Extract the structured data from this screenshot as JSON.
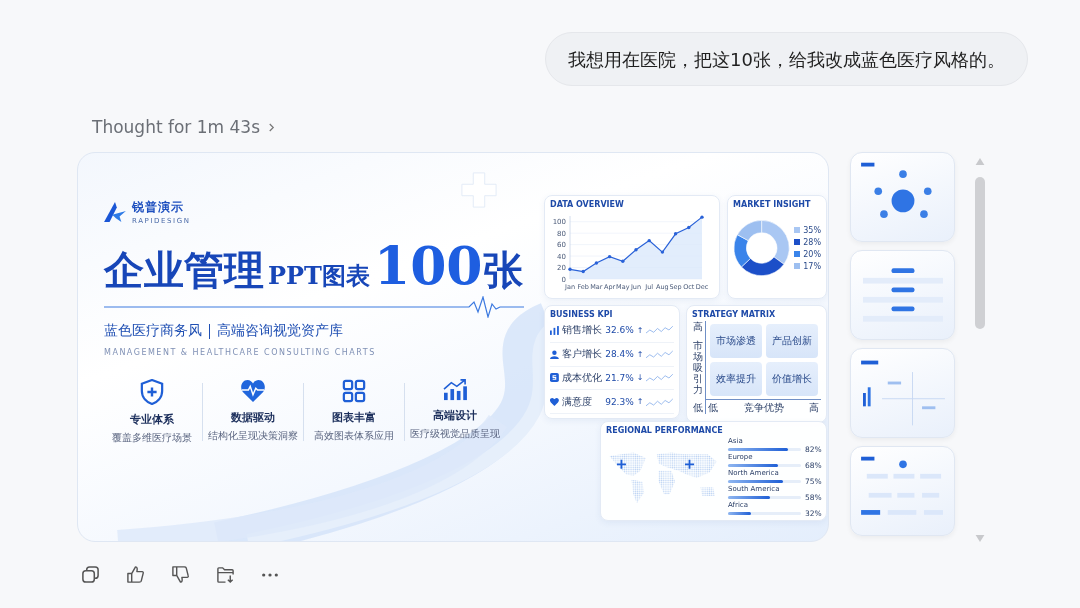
{
  "user_message": "我想用在医院，把这10张，给我改成蓝色医疗风格的。",
  "thought_label": "Thought for 1m 43s",
  "slide": {
    "brand": {
      "name": "锐普演示",
      "subname": "RAPIDESIGN"
    },
    "title_parts": [
      {
        "text": "企业管理",
        "kind": "main"
      },
      {
        "text": "PPT图表",
        "kind": "small"
      },
      {
        "text": "100",
        "kind": "number"
      },
      {
        "text": "张",
        "kind": "main"
      }
    ],
    "subtitle": [
      "蓝色医疗商务风",
      "高端咨询视觉资产库"
    ],
    "tagline": "MANAGEMENT & HEALTHCARE CONSULTING CHARTS",
    "features": [
      {
        "title": "专业体系",
        "note": "覆盖多维医疗场景"
      },
      {
        "title": "数据驱动",
        "note": "结构化呈现决策洞察"
      },
      {
        "title": "图表丰富",
        "note": "高效图表体系应用"
      },
      {
        "title": "高端设计",
        "note": "医疗级视觉品质呈现"
      }
    ],
    "data_overview": {
      "title": "DATA OVERVIEW",
      "chart_data": {
        "type": "area",
        "categories": [
          "Jan",
          "Feb",
          "Mar",
          "Apr",
          "May",
          "Jun",
          "Jul",
          "Aug",
          "Sep",
          "Oct",
          "Dec"
        ],
        "series": [
          {
            "color": "#2a62d8",
            "values": [
              17,
              13,
              28,
              39,
              31,
              51,
              67,
              47,
              79,
              90,
              108
            ]
          }
        ],
        "ylim": [
          0,
          110
        ],
        "yticks": [
          0,
          20,
          40,
          60,
          80,
          100
        ],
        "grid": true
      }
    },
    "market_insight": {
      "title": "MARKET INSIGHT",
      "chart_data": {
        "type": "donut",
        "categories": [
          "35%",
          "28%",
          "20%",
          "17%"
        ],
        "values": [
          35,
          28,
          20,
          17
        ],
        "colors": [
          "#a9c7f3",
          "#1c4fc8",
          "#3a84ea",
          "#9dbff0"
        ],
        "legend": true
      }
    },
    "business_kpi": {
      "title": "BUSINESS KPI",
      "rows": [
        {
          "label": "销售增长",
          "value": "32.6%",
          "arrow": "↑"
        },
        {
          "label": "客户增长",
          "value": "28.4%",
          "arrow": "↑"
        },
        {
          "label": "成本优化",
          "value": "21.7%",
          "arrow": "↓"
        },
        {
          "label": "满意度",
          "value": "92.3%",
          "arrow": "↑"
        }
      ]
    },
    "strategy_matrix": {
      "title": "STRATEGY MATRIX",
      "y_axis": "市场吸引力",
      "y_high": "高",
      "y_low": "低",
      "x_low": "低",
      "x_axis": "竞争优势",
      "x_high": "高",
      "cells": [
        "市场渗透",
        "产品创新",
        "效率提升",
        "价值增长"
      ]
    },
    "regional_performance": {
      "title": "REGIONAL PERFORMANCE",
      "regions": [
        {
          "name": "Asia",
          "level": 0.82,
          "reading": "82%"
        },
        {
          "name": "Europe",
          "level": 0.68,
          "reading": "68%"
        },
        {
          "name": "North America",
          "level": 0.75,
          "reading": "75%"
        },
        {
          "name": "South America",
          "level": 0.58,
          "reading": "58%"
        },
        {
          "name": "Africa",
          "level": 0.32,
          "reading": "32%"
        }
      ]
    }
  },
  "thumbnails": [
    {
      "kind": "radial"
    },
    {
      "kind": "flow"
    },
    {
      "kind": "matrix"
    },
    {
      "kind": "tree"
    }
  ]
}
